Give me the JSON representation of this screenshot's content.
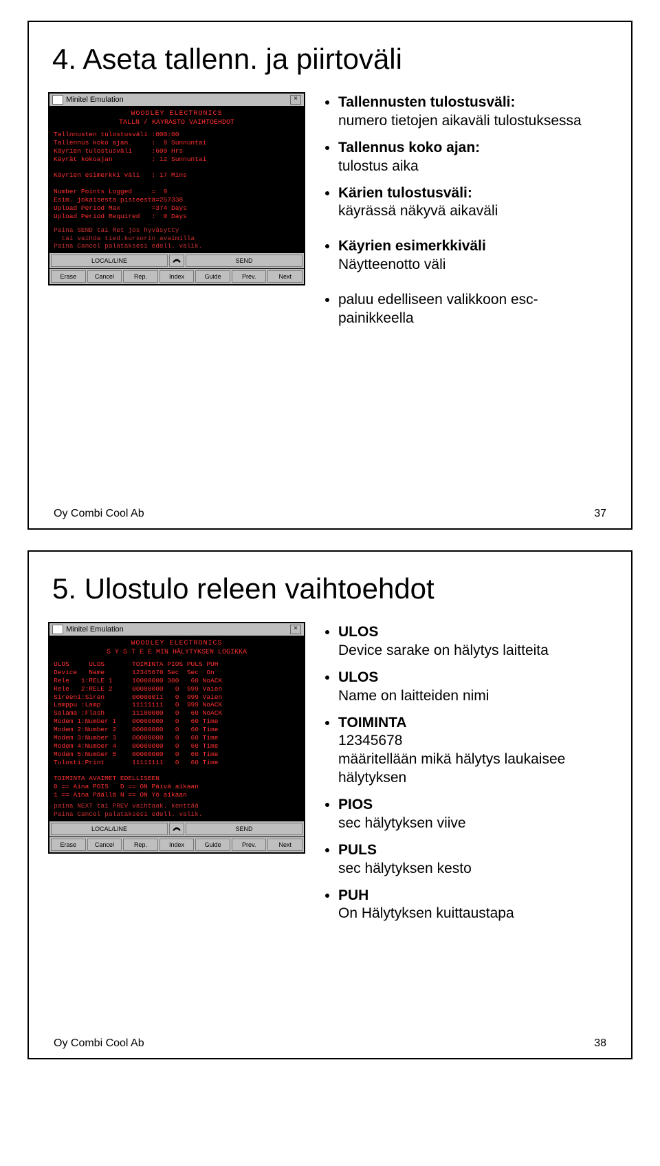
{
  "app_title": "Minitel Emulation",
  "term_header": "WOODLEY ELECTRONICS",
  "buttons_top": [
    "LOCAL/LINE",
    "SEND"
  ],
  "buttons_bot": [
    "Erase",
    "Cancel",
    "Rep.",
    "Index",
    "Guide",
    "Prev.",
    "Next"
  ],
  "slide37": {
    "number": "37",
    "title": "4. Aseta tallenn. ja piirtoväli",
    "bulleted": [
      {
        "b": "Tallennusten tulostusväli:",
        "s": "numero tietojen aikaväli tulostuksessa"
      },
      {
        "b": "Tallennus koko ajan:",
        "s": "tulostus aika"
      },
      {
        "b": "Kärien tulostusväli:",
        "s": "käyrässä näkyvä aikaväli"
      },
      {
        "b": "Käyrien esimerkkiväli",
        "s": "Näytteenotto väli"
      },
      {
        "b": "",
        "s": "paluu edelliseen valikkoon esc-painikkeella"
      }
    ],
    "scr_title": "TALLN / KAYRASTO VAIHTOEHDOT",
    "scr_body": "Tallnnusten tulostusväli :000:00\nTallennus koko ajan      :  9 Sunnuntai\nKäyrien tulostusväli     :600 Hrs\nKäyrät kokoajan          : 12 Sunnuntai\n\nKäyrien esimerkki väli   : 17 Mins\n\nNumber Points Logged     =  9\nEsim. jokaisesta pisteestä=257338\nUpload Period Max        =374 Days\nUpload Period Required   :  0 Days",
    "scr_msg": "Paina SEND tai Ret jos hyväsytty\n  tai vaihda tied.kursorin avaimilla\nPaina Cancel palataksesi edell. valik."
  },
  "slide38": {
    "number": "38",
    "title": "5. Ulostulo releen vaihtoehdot",
    "bulleted": [
      {
        "b": "ULOS",
        "s": "Device sarake on hälytys laitteita"
      },
      {
        "b": "ULOS",
        "s": "Name on laitteiden nimi"
      },
      {
        "b": "TOIMINTA",
        "s": "12345678\nmääritellään mikä hälytys laukaisee hälytyksen"
      },
      {
        "b": "PIOS",
        "s": "sec  hälytyksen viive"
      },
      {
        "b": "PULS",
        "s": "sec  hälytyksen kesto"
      },
      {
        "b": "PUH",
        "s": "On   Hälytyksen kuittaustapa"
      }
    ],
    "scr_title": "S Y S T E E MIN HÄLYTYKSEN LOGIKKA",
    "scr_head": "ULOS     ULOS       TOIMINTA PIOS PULS PUH\nDevice   Name       12345678 Sec  Sec  On",
    "scr_body": "Rele   1:RELE 1     10000000 300   60 NoACK\nRele   2:RELE 2     00000000   0  999 Vaien\nSireeni:Siren       00000011   0  999 Vaien\nLamppu :Lamp        11111111   0  999 NoACK\nSalama :Flash       11100000   0   60 NoACK\nModem 1:Number 1    00000000   0   60 Time\nModem 2:Number 2    00000000   0   60 Time\nModem 3:Number 3    00000000   0   60 Time\nModem 4:Number 4    00000000   0   60 Time\nModem 5:Number 5    00000000   0   60 Time\nTulosti:Print       11111111   0   60 Time\n\nTOIMINTA AVAIMET EDELLISEEN\n0 == Aina POIS   D == ON Päivä aikaan\n1 == Aina Päällä N == ON Yö aikaan",
    "scr_msg": "paina NEXT tai PREV vaihtaak. kenttää\nPaina Cancel palataksesi edell. valik."
  },
  "footer_company": "Oy Combi Cool Ab"
}
